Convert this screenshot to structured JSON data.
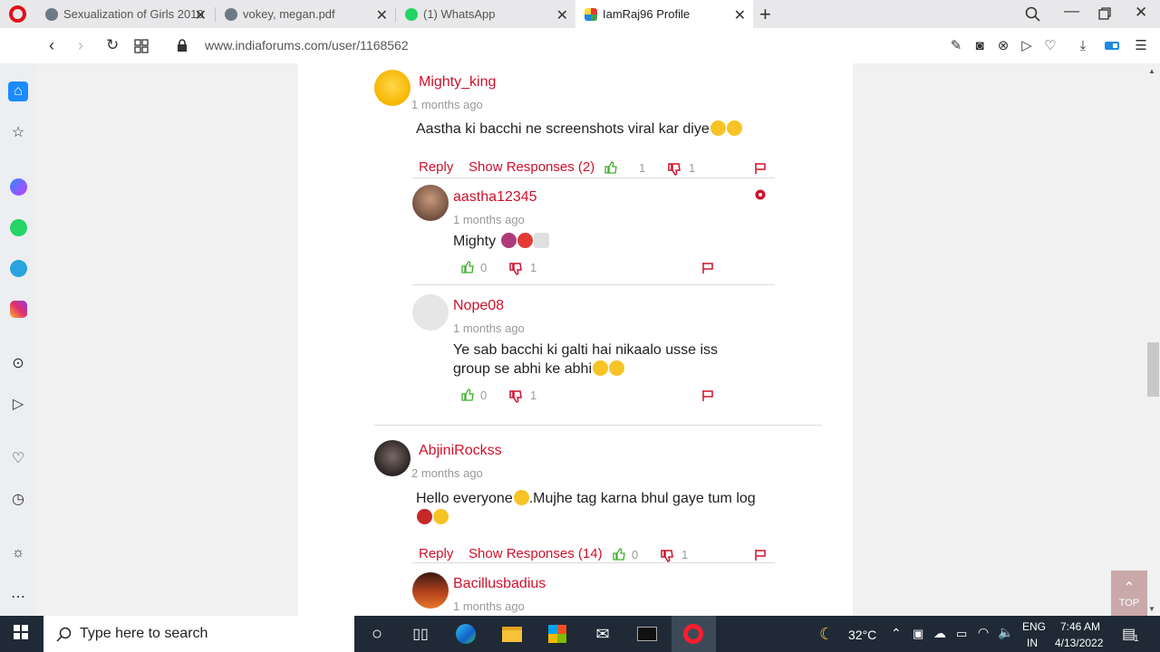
{
  "browser": {
    "tabs": [
      {
        "title": "Sexualization of Girls 2010",
        "active": false
      },
      {
        "title": "vokey, megan.pdf",
        "active": false
      },
      {
        "title": "(1) WhatsApp",
        "active": false
      },
      {
        "title": "IamRaj96 Profile",
        "active": true
      }
    ],
    "url": "www.indiaforums.com/user/1168562"
  },
  "comments": [
    {
      "user": "Mighty_king",
      "time": "1 months ago",
      "text": "Aastha ki bacchi ne screenshots viral kar diye",
      "reply_label": "Reply",
      "responses_label": "Show Responses (2)",
      "likes": "1",
      "dislikes": "1",
      "replies": [
        {
          "user": "aastha12345",
          "time": "1 months ago",
          "text": "Mighty",
          "likes": "0",
          "dislikes": "1"
        },
        {
          "user": "Nope08",
          "time": "1 months ago",
          "text_line1": "Ye sab bacchi ki galti hai nikaalo usse iss",
          "text_line2": "group se abhi ke abhi",
          "likes": "0",
          "dislikes": "1"
        }
      ]
    },
    {
      "user": "AbjiniRockss",
      "time": "2 months ago",
      "text_line1": "Hello everyone",
      "text_line1b": ".Mujhe tag karna bhul gaye tum log",
      "reply_label": "Reply",
      "responses_label": "Show Responses (14)",
      "likes": "0",
      "dislikes": "1",
      "replies": [
        {
          "user": "Bacillusbadius",
          "time": "1 months ago"
        }
      ]
    }
  ],
  "top_button": "TOP",
  "taskbar": {
    "search_placeholder": "Type here to search",
    "temperature": "32°C",
    "lang_line1": "ENG",
    "lang_line2": "IN",
    "time": "7:46 AM",
    "date": "4/13/2022",
    "notif_count": "1"
  },
  "colors": {
    "accent": "#d0112b",
    "like_green": "#3dae2b",
    "taskbar": "#1f2a36"
  }
}
